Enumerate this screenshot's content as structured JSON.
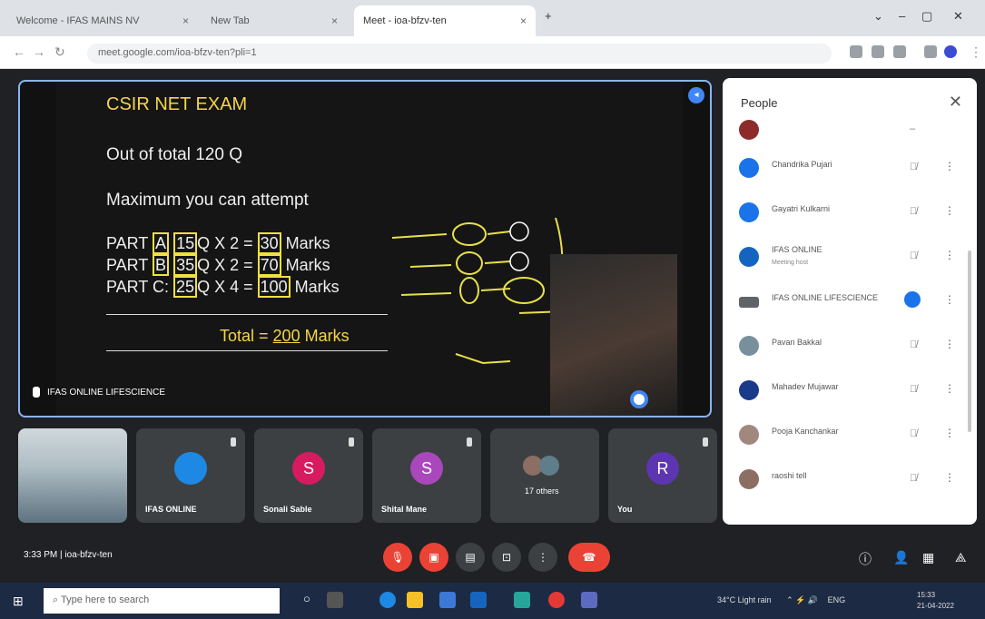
{
  "browser": {
    "tabs": [
      {
        "label": "Welcome - IFAS MAINS NV"
      },
      {
        "label": "New Tab"
      },
      {
        "label": "Meet - ioa-bfzv-ten"
      }
    ],
    "url": "meet.google.com/ioa-bfzv-ten?pli=1"
  },
  "slide": {
    "title": "CSIR NET EXAM",
    "line1": "Out of total 120 Q",
    "line2": "Maximum you can attempt",
    "parts": [
      {
        "prefix": "PART ",
        "part": "A",
        "sep": " ",
        "q": "15",
        "mid": "Q X 2 = ",
        "marks": "30",
        "suffix": " Marks"
      },
      {
        "prefix": "PART ",
        "part": "B",
        "sep": " ",
        "q": "35",
        "mid": "Q X 2 = ",
        "marks": "70",
        "suffix": " Marks"
      },
      {
        "prefix": "PART C: ",
        "part": "",
        "sep": "",
        "q": "25",
        "mid": "Q X 4 = ",
        "marks": "100",
        "suffix": " Marks"
      }
    ],
    "total_label": "Total = ",
    "total_value": "200",
    "total_suffix": " Marks"
  },
  "presenter": {
    "label": "IFAS ONLINE LIFESCIENCE"
  },
  "tiles": [
    {
      "name": "",
      "initial": "",
      "color": "#90a4ae"
    },
    {
      "name": "IFAS ONLINE",
      "initial": "",
      "color": "#1e88e5"
    },
    {
      "name": "Sonali Sable",
      "initial": "S",
      "color": "#d81b60"
    },
    {
      "name": "Shital Mane",
      "initial": "S",
      "color": "#ab47bc"
    },
    {
      "name": "17 others",
      "initial": "",
      "color": "#5f6368"
    },
    {
      "name": "You",
      "initial": "R",
      "color": "#5e35b1"
    }
  ],
  "people": {
    "title": "People",
    "list": [
      {
        "name": "",
        "sub": "",
        "color": "#8d2b2b"
      },
      {
        "name": "Chandrika Pujari",
        "sub": "",
        "color": "#1a73e8"
      },
      {
        "name": "Gayatri Kulkarni",
        "sub": "",
        "color": "#1a73e8"
      },
      {
        "name": "IFAS ONLINE",
        "sub": "Meeting host",
        "color": "#1565c0"
      },
      {
        "name": "IFAS ONLINE LIFESCIENCE",
        "sub": "",
        "color": "#5f6368"
      },
      {
        "name": "Pavan Bakkal",
        "sub": "",
        "color": "#78909c"
      },
      {
        "name": "Mahadev Mujawar",
        "sub": "",
        "color": "#1a3a8a"
      },
      {
        "name": "Pooja Kanchankar",
        "sub": "",
        "color": "#a1887f"
      },
      {
        "name": "raoshi tell",
        "sub": "",
        "color": "#8d6e63"
      }
    ]
  },
  "bottom": {
    "time": "3:33 PM",
    "sep": "|",
    "code": "ioa-bfzv-ten"
  },
  "taskbar": {
    "search_placeholder": "Type here to search",
    "weather": "34°C  Light rain",
    "lang": "ENG",
    "time": "15:33",
    "date": "21-04-2022"
  }
}
